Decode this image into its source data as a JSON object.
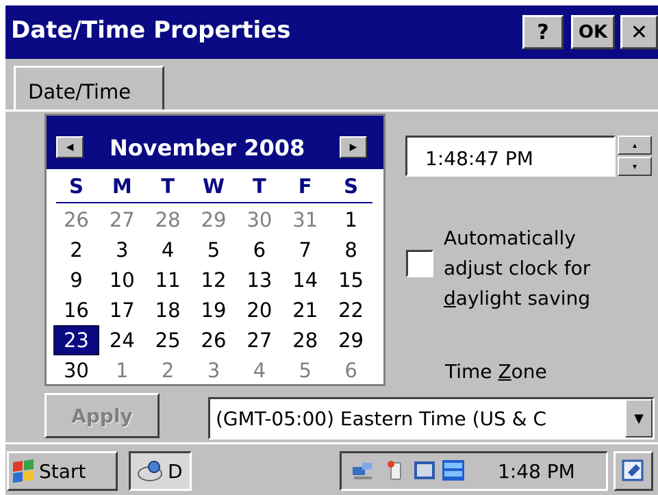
{
  "window": {
    "title": "Date/Time Properties",
    "help_label": "?",
    "ok_label": "OK",
    "close_label": "✕"
  },
  "tabs": [
    {
      "label": "Date/Time"
    }
  ],
  "calendar": {
    "month_year": "November 2008",
    "prev_label": "◀",
    "next_label": "▶",
    "dow": [
      "S",
      "M",
      "T",
      "W",
      "T",
      "F",
      "S"
    ],
    "weeks": [
      [
        {
          "d": "26",
          "o": 1
        },
        {
          "d": "27",
          "o": 1
        },
        {
          "d": "28",
          "o": 1
        },
        {
          "d": "29",
          "o": 1
        },
        {
          "d": "30",
          "o": 1
        },
        {
          "d": "31",
          "o": 1
        },
        {
          "d": "1",
          "o": 0
        }
      ],
      [
        {
          "d": "2",
          "o": 0
        },
        {
          "d": "3",
          "o": 0
        },
        {
          "d": "4",
          "o": 0
        },
        {
          "d": "5",
          "o": 0
        },
        {
          "d": "6",
          "o": 0
        },
        {
          "d": "7",
          "o": 0
        },
        {
          "d": "8",
          "o": 0
        }
      ],
      [
        {
          "d": "9",
          "o": 0
        },
        {
          "d": "10",
          "o": 0
        },
        {
          "d": "11",
          "o": 0
        },
        {
          "d": "12",
          "o": 0
        },
        {
          "d": "13",
          "o": 0
        },
        {
          "d": "14",
          "o": 0
        },
        {
          "d": "15",
          "o": 0
        }
      ],
      [
        {
          "d": "16",
          "o": 0
        },
        {
          "d": "17",
          "o": 0
        },
        {
          "d": "18",
          "o": 0
        },
        {
          "d": "19",
          "o": 0
        },
        {
          "d": "20",
          "o": 0
        },
        {
          "d": "21",
          "o": 0
        },
        {
          "d": "22",
          "o": 0
        }
      ],
      [
        {
          "d": "23",
          "o": 0,
          "sel": 1
        },
        {
          "d": "24",
          "o": 0
        },
        {
          "d": "25",
          "o": 0
        },
        {
          "d": "26",
          "o": 0
        },
        {
          "d": "27",
          "o": 0
        },
        {
          "d": "28",
          "o": 0
        },
        {
          "d": "29",
          "o": 0
        }
      ],
      [
        {
          "d": "30",
          "o": 0
        },
        {
          "d": "1",
          "o": 1
        },
        {
          "d": "2",
          "o": 1
        },
        {
          "d": "3",
          "o": 1
        },
        {
          "d": "4",
          "o": 1
        },
        {
          "d": "5",
          "o": 1
        },
        {
          "d": "6",
          "o": 1
        }
      ]
    ]
  },
  "time": {
    "value": "1:48:47 PM",
    "spin_up": "▴",
    "spin_down": "▾"
  },
  "dst": {
    "checked": false,
    "label_line1": "Automatically",
    "label_line2": "adjust clock for",
    "label_line3_u": "d",
    "label_line3_rest": "aylight saving"
  },
  "timezone": {
    "label_pre": "Time ",
    "label_u": "Z",
    "label_post": "one",
    "value": "(GMT-05:00) Eastern Time (US & C",
    "drop_icon": "▼"
  },
  "apply_label": "Apply",
  "taskbar": {
    "start_label": "Start",
    "task_label": "D",
    "clock": "1:48 PM"
  },
  "colors": {
    "title_bg": "#0a0a84",
    "face": "#c0c0c0",
    "disabled_text": "#808080"
  }
}
